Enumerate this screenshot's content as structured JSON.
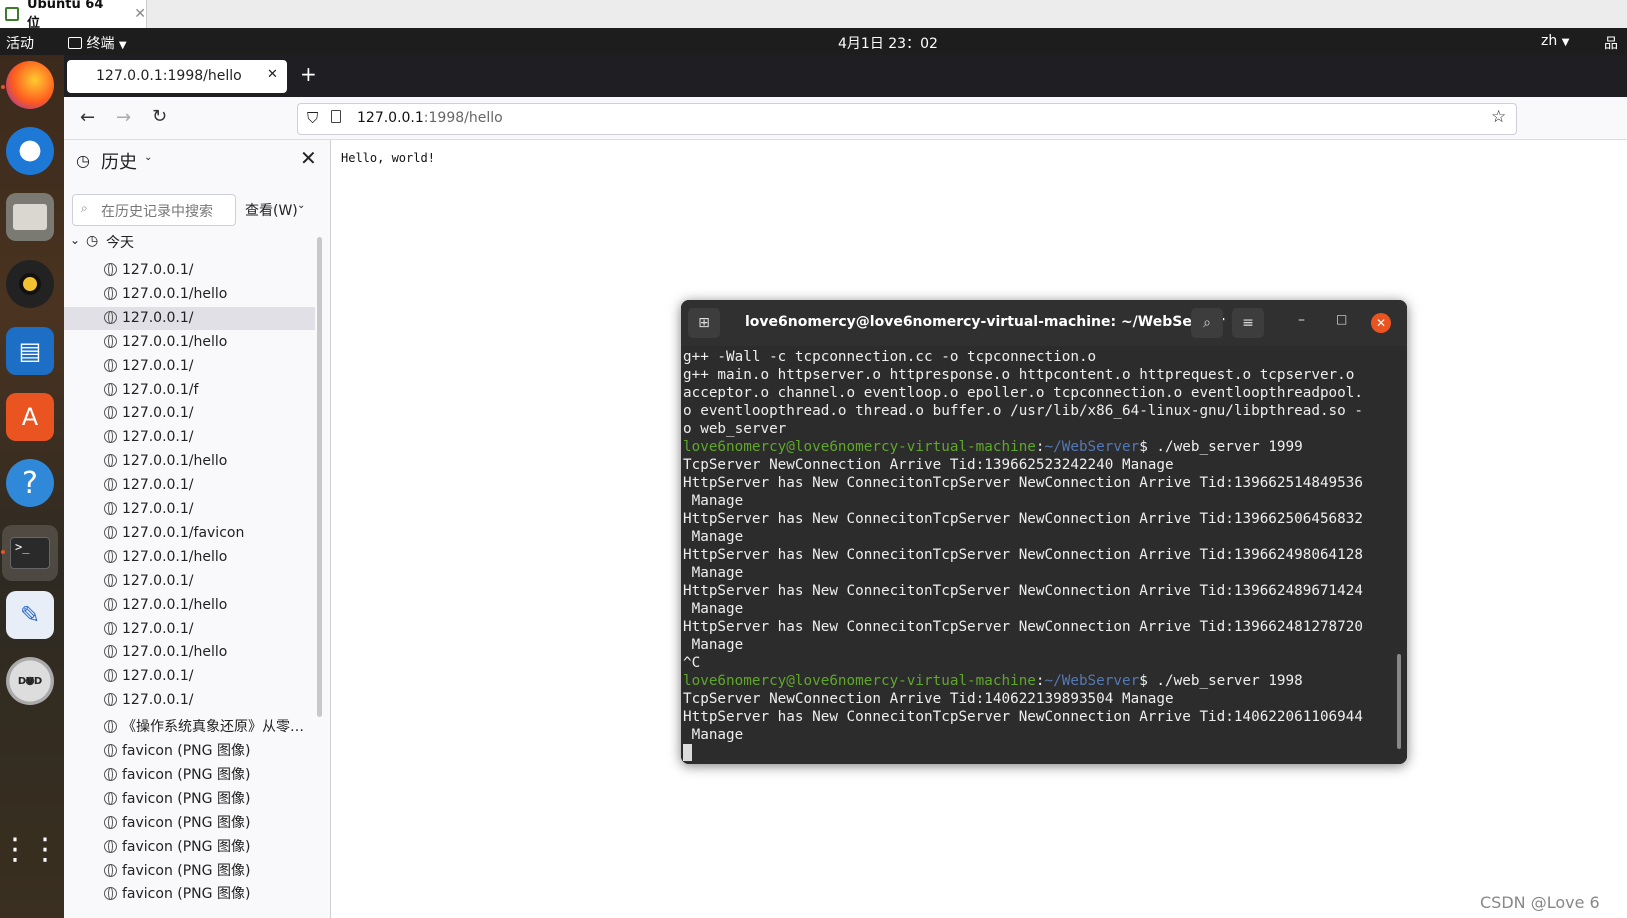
{
  "vm": {
    "tab_title": "Ubuntu 64 位",
    "close": "✕"
  },
  "topbar": {
    "activities": "活动",
    "app": "终端",
    "clock": "4月1日 23：02",
    "lang": "zh"
  },
  "browser": {
    "tab_title": "127.0.0.1:1998/hello",
    "tab_close": "✕",
    "new_tab": "+",
    "url_host": "127.0.0.1",
    "url_rest": ":1998/hello",
    "page_text": "Hello, world!"
  },
  "sidebar": {
    "title": "历史",
    "search_placeholder": "在历史记录中搜索",
    "view_menu": "查看(W)",
    "group": "今天",
    "items": [
      "127.0.0.1/",
      "127.0.0.1/hello",
      "127.0.0.1/",
      "127.0.0.1/hello",
      "127.0.0.1/",
      "127.0.0.1/f",
      "127.0.0.1/",
      "127.0.0.1/",
      "127.0.0.1/hello",
      "127.0.0.1/",
      "127.0.0.1/",
      "127.0.0.1/favicon",
      "127.0.0.1/hello",
      "127.0.0.1/",
      "127.0.0.1/hello",
      "127.0.0.1/",
      "127.0.0.1/hello",
      "127.0.0.1/",
      "127.0.0.1/",
      "《操作系统真象还原》从零…",
      "favicon (PNG 图像)",
      "favicon (PNG 图像)",
      "favicon (PNG 图像)",
      "favicon (PNG 图像)",
      "favicon (PNG 图像)",
      "favicon (PNG 图像)",
      "favicon (PNG 图像)"
    ]
  },
  "terminal": {
    "title": "love6nomercy@love6nomercy-virtual-machine: ~/WebServer",
    "lines": [
      {
        "t": "g++ -Wall -c tcpconnection.cc -o tcpconnection.o"
      },
      {
        "t": "g++ main.o httpserver.o httpresponse.o httpcontent.o httprequest.o tcpserver.o"
      },
      {
        "t": "acceptor.o channel.o eventloop.o epoller.o tcpconnection.o eventloopthreadpool."
      },
      {
        "t": "o eventloopthread.o thread.o buffer.o /usr/lib/x86_64-linux-gnu/libpthread.so -"
      },
      {
        "t": "o web_server"
      },
      {
        "user": "love6nomercy@love6nomercy-virtual-machine",
        "path": "~/WebServer",
        "cmd": "$ ./web_server 1999"
      },
      {
        "t": "TcpServer NewConnection Arrive Tid:139662523242240 Manage"
      },
      {
        "t": "HttpServer has New ConnecitonTcpServer NewConnection Arrive Tid:139662514849536"
      },
      {
        "t": " Manage"
      },
      {
        "t": "HttpServer has New ConnecitonTcpServer NewConnection Arrive Tid:139662506456832"
      },
      {
        "t": " Manage"
      },
      {
        "t": "HttpServer has New ConnecitonTcpServer NewConnection Arrive Tid:139662498064128"
      },
      {
        "t": " Manage"
      },
      {
        "t": "HttpServer has New ConnecitonTcpServer NewConnection Arrive Tid:139662489671424"
      },
      {
        "t": " Manage"
      },
      {
        "t": "HttpServer has New ConnecitonTcpServer NewConnection Arrive Tid:139662481278720"
      },
      {
        "t": " Manage"
      },
      {
        "t": "^C"
      },
      {
        "user": "love6nomercy@love6nomercy-virtual-machine",
        "path": "~/WebServer",
        "cmd": "$ ./web_server 1998"
      },
      {
        "t": "TcpServer NewConnection Arrive Tid:140622139893504 Manage"
      },
      {
        "t": "HttpServer has New ConnecitonTcpServer NewConnection Arrive Tid:140622061106944"
      },
      {
        "t": " Manage"
      }
    ]
  },
  "watermark": "CSDN @Love 6"
}
